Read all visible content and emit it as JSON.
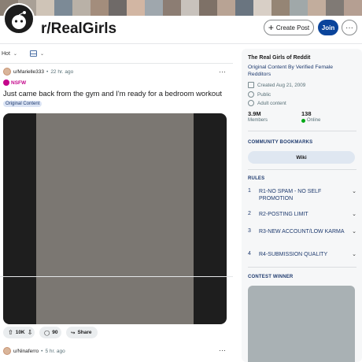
{
  "banner": {
    "colors": [
      "#8a7f74",
      "#a9a096",
      "#cfc4b7",
      "#7c8a96",
      "#b9b1a7",
      "#a38d7c",
      "#6f6a68",
      "#d2b6a3",
      "#9fa7ad",
      "#8c7d73",
      "#c8c2bc",
      "#7e7167",
      "#b8a394",
      "#6a7580",
      "#d8cfc6",
      "#958575",
      "#a0a8a9",
      "#c2ad9d",
      "#807a75",
      "#b59f92"
    ]
  },
  "subreddit": {
    "name": "r/RealGirls",
    "avatar": "reddit-snoo-icon",
    "create_post_label": "Create Post",
    "join_label": "Join",
    "more_label": "···"
  },
  "sort": {
    "label": "Hot",
    "chevron": "⌄",
    "layout_icon": "card-view-icon"
  },
  "post": {
    "author": "u/Marielle333",
    "time": "22 hr. ago",
    "more_label": "···",
    "nsfw_label": "NSFW",
    "title": "Just came back from the gym and I'm ready for a bedroom workout",
    "flair": "Original Content",
    "votes": "10K",
    "comments": "90",
    "share_label": "Share",
    "upvote_glyph": "⇧",
    "downvote_glyph": "⇩",
    "comment_glyph": "◯",
    "share_glyph": "↪"
  },
  "next_post": {
    "author": "u/Ninaferro",
    "time": "5 hr. ago",
    "more_label": "···"
  },
  "sidebar": {
    "title": "The Real Girls of Reddit",
    "description": "Original Content By Verified Female Redditors",
    "created": "Created Aug 21, 2009",
    "visibility": "Public",
    "content_type": "Adult content",
    "members_count": "3.9M",
    "members_label": "Members",
    "online_count": "138",
    "online_label": "Online",
    "bookmarks_heading": "COMMUNITY BOOKMARKS",
    "wiki_label": "Wiki",
    "rules_heading": "RULES",
    "rules": [
      {
        "num": "1",
        "text": "R1-NO SPAM - NO SELF PROMOTION"
      },
      {
        "num": "2",
        "text": "R2-POSTING LIMIT"
      },
      {
        "num": "3",
        "text": "R3-NEW ACCOUNT/LOW KARMA"
      },
      {
        "num": "4",
        "text": "R4-SUBMISSION QUALITY"
      }
    ],
    "rule_chevron": "⌄",
    "contest_heading": "CONTEST WINNER"
  },
  "colors": {
    "join": "#0a449b",
    "nsfw": "#c4068b",
    "flair_bg": "#dbe4f5",
    "online": "#01a816"
  }
}
